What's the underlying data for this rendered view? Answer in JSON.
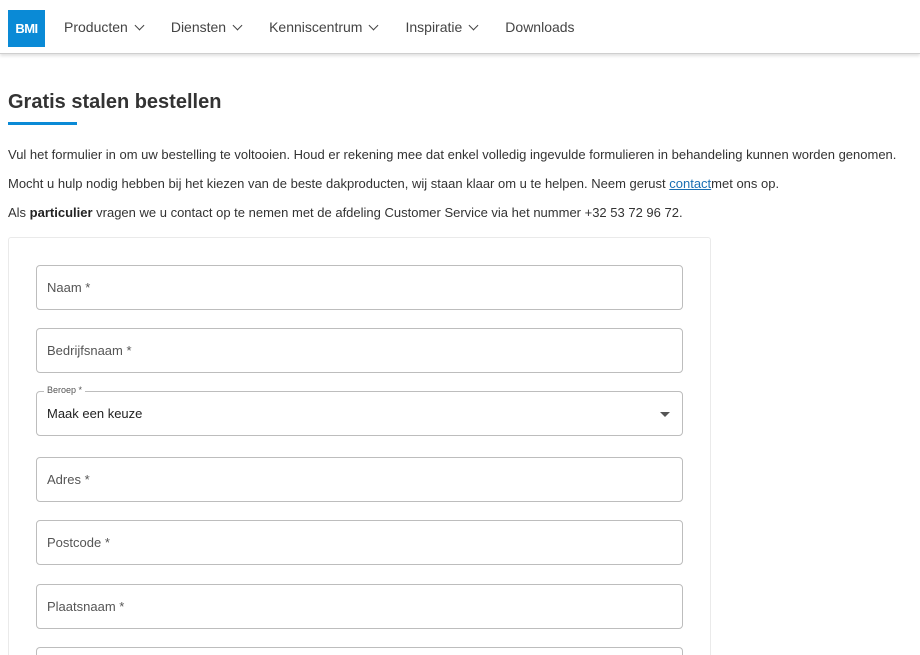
{
  "header": {
    "logo_text": "BMI",
    "nav": [
      {
        "label": "Producten",
        "has_dropdown": true
      },
      {
        "label": "Diensten",
        "has_dropdown": true
      },
      {
        "label": "Kenniscentrum",
        "has_dropdown": true
      },
      {
        "label": "Inspiratie",
        "has_dropdown": true
      },
      {
        "label": "Downloads",
        "has_dropdown": false
      }
    ]
  },
  "page": {
    "title": "Gratis stalen bestellen",
    "intro1": "Vul het formulier in om uw bestelling te voltooien. Houd er rekening mee dat enkel volledig ingevulde formulieren in behandeling kunnen worden genomen.",
    "intro2_before": "Mocht u hulp nodig hebben bij het kiezen van de beste dakproducten, wij staan klaar om u te helpen. Neem gerust ",
    "intro2_link": "contact",
    "intro2_after": "met ons op.",
    "intro3_before": "Als ",
    "intro3_bold": "particulier",
    "intro3_after": " vragen we u contact op te nemen met de afdeling Customer Service via het nummer +32 53 72 96 72."
  },
  "form": {
    "naam": {
      "placeholder": "Naam *",
      "value": ""
    },
    "bedrijfsnaam": {
      "placeholder": "Bedrijfsnaam *",
      "value": ""
    },
    "beroep": {
      "label": "Beroep *",
      "value": "Maak een keuze"
    },
    "adres": {
      "placeholder": "Adres *",
      "value": ""
    },
    "postcode": {
      "placeholder": "Postcode *",
      "value": ""
    },
    "plaatsnaam": {
      "placeholder": "Plaatsnaam *",
      "value": ""
    }
  },
  "colors": {
    "brand_blue": "#0a8ad6",
    "link": "#1a6fb3"
  }
}
